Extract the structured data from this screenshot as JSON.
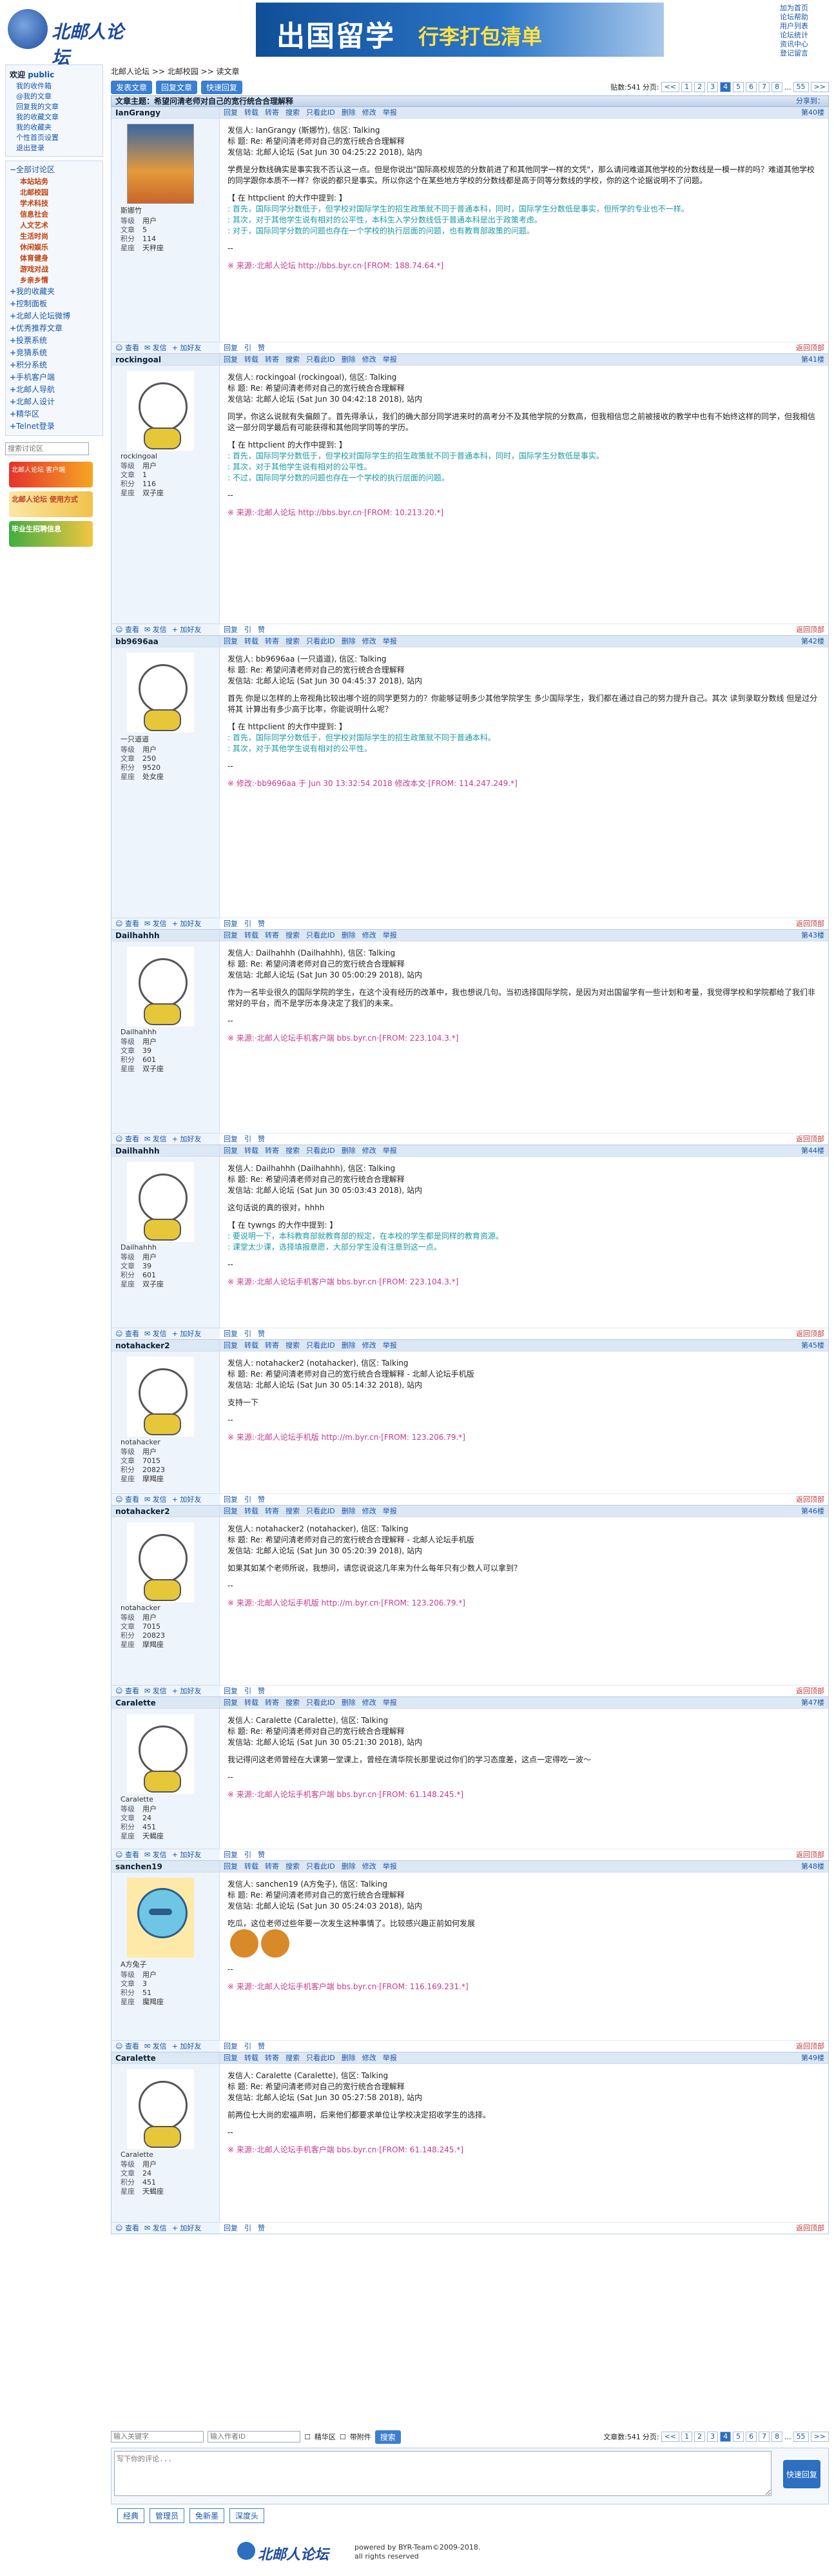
{
  "header": {
    "logo_text": "北邮人论坛",
    "banner_main": "出国留学",
    "banner_sub": "行李打包清单",
    "top_links": [
      "加为首页",
      "论坛帮助",
      "用户列表",
      "论坛统计",
      "资讯中心",
      "登记留言"
    ]
  },
  "sidebar": {
    "welcome_label": "欢迎",
    "welcome_user": "public",
    "user_links": [
      "我的收件箱",
      "@我的文章",
      "回复我的文章",
      "我的收藏文章",
      "我的收藏夹",
      "个性首页设置",
      "退出登录"
    ],
    "sections": [
      {
        "label": "全部讨论区",
        "subs": [
          "本站站务",
          "北邮校园",
          "学术科技",
          "信息社会",
          "人文艺术",
          "生活时尚",
          "休闲娱乐",
          "体育健身",
          "游戏对战",
          "乡亲乡情"
        ]
      },
      {
        "label": "我的收藏夹",
        "subs": []
      },
      {
        "label": "控制面板",
        "subs": []
      },
      {
        "label": "北邮人论坛微博",
        "subs": []
      },
      {
        "label": "优秀推荐文章",
        "subs": []
      },
      {
        "label": "投票系统",
        "subs": []
      },
      {
        "label": "竞猜系统",
        "subs": []
      },
      {
        "label": "积分系统",
        "subs": []
      },
      {
        "label": "手机客户端",
        "subs": []
      },
      {
        "label": "北邮人导航",
        "subs": []
      },
      {
        "label": "北邮人设计",
        "subs": []
      },
      {
        "label": "精华区",
        "subs": []
      },
      {
        "label": "Telnet登录",
        "subs": []
      }
    ],
    "search_placeholder": "搜索讨论区",
    "promo1": "北邮人论坛 客户端",
    "promo2": "北邮人论坛 使用方式",
    "promo3": "毕业生招聘信息"
  },
  "breadcrumb": "北邮人论坛 >> 北邮校园 >> 读文章",
  "toolbar": {
    "new_post": "发表文章",
    "reply": "回复文章",
    "quick_reply": "快速回复",
    "total_label": "贴数:541",
    "page_label": "分页:",
    "pages": [
      "1",
      "2",
      "3",
      "4",
      "5",
      "6",
      "7",
      "8",
      "...",
      "55"
    ]
  },
  "title_bar": {
    "label": "文章主题：希望问清老师对自己的宽行统合合理解释",
    "right": "分享到："
  },
  "post_actions": [
    "回复",
    "转载",
    "转寄",
    "搜索",
    "只看此ID",
    "删除",
    "修改",
    "举报"
  ],
  "foot_actions": [
    "回复",
    "引",
    "赞"
  ],
  "top_label": "返回顶部",
  "stat_keys": [
    "等级",
    "文章",
    "积分",
    "星座"
  ],
  "posts": [
    {
      "user": "IanGrangy",
      "floor": "第40楼",
      "avatar": "photo",
      "nick": "斯娜竹",
      "stats": [
        "用户",
        "5",
        "114",
        "天秤座"
      ],
      "meta": [
        "发信人: IanGrangy (斯娜竹), 信区: Talking",
        "标 题: Re: 希望问清老师对自己的宽行统合合理解释",
        "发信站: 北邮人论坛 (Sat Jun 30 04:25:22 2018), 站内"
      ],
      "body": "学费是分数线确实是事实我不否认这一点。但是你说出\"国际高校规范的分数前进了和其他同学一样的文凭\"，那么请问难道其他学校的分数线是一模一样的吗？难道其他学校的同学跟你本质不一样？你说的都只是事实。所以你这个在某些地方学校的分数线都是高于同等分数线的学校，你的这个论据说明不了问题。",
      "quote_head": "【 在 httpclient 的大作中提到: 】",
      "quote": [
        ": 首先，国际同学分数低于，但学校对国际学生的招生政策就不同于普通本科，同时，国际学生分数低是事实，但所学的专业也不一样。",
        ": 其次，对于其他学生说有相对的公平性，本科生入学分数线低于普通本科是出于政策考虑。",
        ": 对于，国际同学分数的问题也存在一个学校的执行层面的问题，也有教育部政策的问题。"
      ],
      "source": "※ 来源:·北邮人论坛 http://bbs.byr.cn·[FROM: 188.74.64.*]",
      "foot_top": "返回顶部"
    },
    {
      "user": "rockingoal",
      "floor": "第41楼",
      "avatar": "bear",
      "nick": "rockingoal",
      "stats": [
        "用户",
        "1",
        "116",
        "双子座"
      ],
      "meta": [
        "发信人: rockingoal (rockingoal), 信区: Talking",
        "标 题: Re: 希望问清老师对自己的宽行统合合理解释",
        "发信站: 北邮人论坛 (Sat Jun 30 04:42:18 2018), 站内"
      ],
      "body": "同学，你这么说就有失偏颇了。首先得承认，我们的确大部分同学进来时的高考分不及其他学院的分数高，但我相信您之前被接收的教学中也有不始终这样的同学，但我相信这一部分同学最后有可能获得和其他同学同等的学历。",
      "quote_head": "【 在 httpclient 的大作中提到: 】",
      "quote": [
        ": 首先，国际同学分数低于，但学校对国际学生的招生政策就不同于普通本科，同时，国际学生分数低是事实。",
        ": 其次，对于其他学生说有相对的公平性。",
        ": 不过，国际同学分数的问题也存在一个学校的执行层面的问题。"
      ],
      "source": "※ 来源:·北邮人论坛 http://bbs.byr.cn·[FROM: 10.213.20.*]",
      "foot_top": "返回顶部"
    },
    {
      "user": "bb9696aa",
      "floor": "第42楼",
      "avatar": "bear",
      "nick": "一只道道",
      "stats": [
        "用户",
        "250",
        "9520",
        "处女座"
      ],
      "meta": [
        "发信人: bb9696aa (一只道道), 信区: Talking",
        "标 题: Re: 希望问清老师对自己的宽行统合合理解释",
        "发信站: 北邮人论坛 (Sat Jun 30 04:45:37 2018), 站内"
      ],
      "body": "首先 你是以怎样的上帝视角比较出哪个班的同学更努力的？你能够证明多少其他学院学生 多少国际学生，我们都在通过自己的努力提升自己。其次 读到录取分数线 但是过分将其 计算出有多少高于比率，你能说明什么呢？",
      "quote_head": "【 在 httpclient 的大作中提到: 】",
      "quote": [
        ": 首先，国际同学分数低于，但学校对国际学生的招生政策就不同于普通本科。",
        ": 其次，对于其他学生说有相对的公平性。"
      ],
      "source": "※ 修改:·bb9696aa 于 Jun 30 13:32:54 2018 修改本文·[FROM: 114.247.249.*]",
      "foot_top": "返回顶部"
    },
    {
      "user": "Dailhahhh",
      "floor": "第43楼",
      "avatar": "bear",
      "nick": "Dailhahhh",
      "stats": [
        "用户",
        "39",
        "601",
        "双子座"
      ],
      "meta": [
        "发信人: Dailhahhh (Dailhahhh), 信区: Talking",
        "标 题: Re: 希望问清老师对自己的宽行统合合理解释",
        "发信站: 北邮人论坛 (Sat Jun 30 05:00:29 2018), 站内"
      ],
      "body": "作为一名毕业很久的国际学院的学生，在这个没有经历的改革中，我也想说几句。当初选择国际学院，是因为对出国留学有一些计划和考量，我觉得学校和学院都给了我们非常好的平台，而不是学历本身决定了我们的未来。",
      "quote_head": "",
      "quote": [],
      "source": "※ 来源:·北邮人论坛手机客户端 bbs.byr.cn·[FROM: 223.104.3.*]",
      "foot_top": "返回顶部"
    },
    {
      "user": "Dailhahhh",
      "floor": "第44楼",
      "avatar": "bear",
      "nick": "Dailhahhh",
      "stats": [
        "用户",
        "39",
        "601",
        "双子座"
      ],
      "meta": [
        "发信人: Dailhahhh (Dailhahhh), 信区: Talking",
        "标 题: Re: 希望问清老师对自己的宽行统合合理解释",
        "发信站: 北邮人论坛 (Sat Jun 30 05:03:43 2018), 站内"
      ],
      "body": "这句话说的真的很对，hhhh",
      "quote_head": "【 在 tywngs 的大作中提到: 】",
      "quote": [
        ": 要说明一下，本科教育部就教育部的规定，在本校的学生都是同样的教育资源。",
        ": 课堂太少课，选择填报意愿，大部分学生没有注意到这一点。"
      ],
      "source": "※ 来源:·北邮人论坛手机客户端 bbs.byr.cn·[FROM: 223.104.3.*]",
      "foot_top": "返回顶部"
    },
    {
      "user": "notahacker2",
      "floor": "第45楼",
      "avatar": "bear",
      "nick": "notahacker",
      "stats": [
        "用户",
        "7015",
        "20823",
        "摩羯座"
      ],
      "meta": [
        "发信人: notahacker2 (notahacker), 信区: Talking",
        "标 题: Re: 希望问清老师对自己的宽行统合合理解释 - 北邮人论坛手机版",
        "发信站: 北邮人论坛 (Sat Jun 30 05:14:32 2018), 站内"
      ],
      "body": "支持一下",
      "quote_head": "",
      "quote": [],
      "source": "※ 来源:·北邮人论坛手机版 http://m.byr.cn·[FROM: 123.206.79.*]",
      "foot_top": "返回顶部"
    },
    {
      "user": "notahacker2",
      "floor": "第46楼",
      "avatar": "bear",
      "nick": "notahacker",
      "stats": [
        "用户",
        "7015",
        "20823",
        "摩羯座"
      ],
      "meta": [
        "发信人: notahacker2 (notahacker), 信区: Talking",
        "标 题: Re: 希望问清老师对自己的宽行统合合理解释 - 北邮人论坛手机版",
        "发信站: 北邮人论坛 (Sat Jun 30 05:20:39 2018), 站内"
      ],
      "body": "如果其如某个老师所说，我想问，请您说说这几年来为什么每年只有少数人可以拿到？",
      "quote_head": "",
      "quote": [],
      "source": "※ 来源:·北邮人论坛手机版 http://m.byr.cn·[FROM: 123.206.79.*]",
      "foot_top": "返回顶部"
    },
    {
      "user": "Caralette",
      "floor": "第47楼",
      "avatar": "bear",
      "nick": "Caralette",
      "stats": [
        "用户",
        "24",
        "451",
        "天蝎座"
      ],
      "meta": [
        "发信人: Caralette (Caralette), 信区: Talking",
        "标 题: Re: 希望问清老师对自己的宽行统合合理解释",
        "发信站: 北邮人论坛 (Sat Jun 30 05:21:30 2018), 站内"
      ],
      "body": "我记得问这老师曾经在大课第一堂课上，曾经在清华院长那里说过你们的学习态度差，这点一定得吃一波～",
      "quote_head": "",
      "quote": [],
      "source": "※ 来源:·北邮人论坛手机客户端 bbs.byr.cn·[FROM: 61.148.245.*]",
      "foot_top": "返回顶部"
    },
    {
      "user": "sanchen19",
      "floor": "第48楼",
      "avatar": "cartoon",
      "nick": "A方兔子",
      "stats": [
        "用户",
        "3",
        "51",
        "魔羯座"
      ],
      "meta": [
        "发信人: sanchen19 (A方兔子), 信区: Talking",
        "标 题: Re: 希望问清老师对自己的宽行统合合理解释",
        "发信站: 北邮人论坛 (Sat Jun 30 05:24:03 2018), 站内"
      ],
      "body": "吃瓜，这位老师过些年要一次发生这种事情了。比较感兴趣正前如何发展",
      "quote_head": "",
      "quote": [],
      "source": "※ 来源:·北邮人论坛手机客户端 bbs.byr.cn·[FROM: 116.169.231.*]",
      "foot_top": "返回顶部"
    },
    {
      "user": "Caralette",
      "floor": "第49楼",
      "avatar": "bear",
      "nick": "Caralette",
      "stats": [
        "用户",
        "24",
        "451",
        "天蝎座"
      ],
      "meta": [
        "发信人: Caralette (Caralette), 信区: Talking",
        "标 题: Re: 希望问清老师对自己的宽行统合合理解释",
        "发信站: 北邮人论坛 (Sat Jun 30 05:27:58 2018), 站内"
      ],
      "body": "前两位七大尚的宏福声明，后来他们都要求单位让学校决定招收学生的选择。",
      "quote_head": "",
      "quote": [],
      "source": "※ 来源:·北邮人论坛手机客户端 bbs.byr.cn·[FROM: 61.148.245.*]",
      "foot_top": "返回顶部"
    }
  ],
  "bottom": {
    "search_user_placeholder": "输入关键字",
    "search_author_placeholder": "输入作者ID",
    "checkbox1": "精华区",
    "checkbox2": "带附件",
    "search_btn": "搜索",
    "total_label": "文章数:541",
    "page_label": "分页:",
    "pages": [
      "1",
      "2",
      "3",
      "4",
      "5",
      "6",
      "7",
      "8",
      "...",
      "55"
    ]
  },
  "reply": {
    "placeholder": "写下你的评论...",
    "button": "快速回复"
  },
  "foot_links": [
    "经典",
    "管理员",
    "免新墨",
    "深度头"
  ],
  "footer": {
    "logo": "北邮人论坛",
    "line1": "powered by BYR-Team©2009-2018.",
    "line2": "all rights reserved"
  }
}
